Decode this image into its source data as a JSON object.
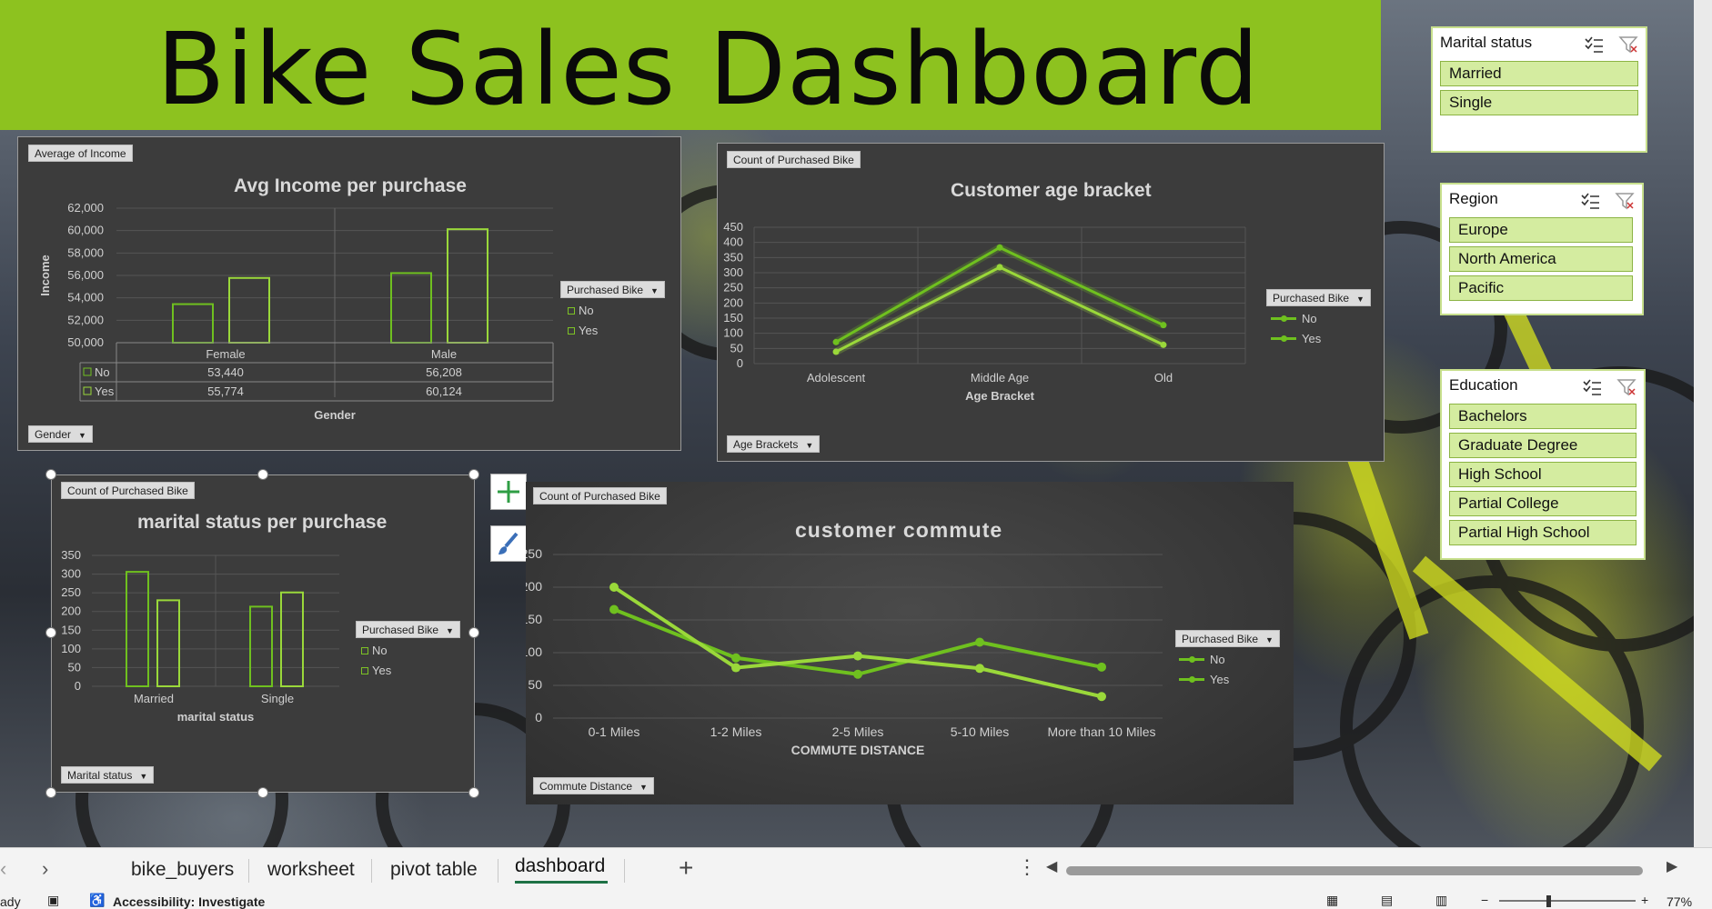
{
  "dashboard_title": "Bike Sales Dashboard",
  "colors": {
    "banner": "#8dc21f",
    "series_no": "#6fc01f",
    "series_yes": "#9ad83a",
    "chart_bg": "#3c3c3c",
    "slicer_item": "#d4eca0"
  },
  "charts": {
    "income": {
      "field_value": "Average of Income",
      "field_axis": "Gender",
      "legend_field": "Purchased Bike",
      "legend": [
        "No",
        "Yes"
      ],
      "table_rows": [
        {
          "label": "No",
          "female": "53,440",
          "male": "56,208"
        },
        {
          "label": "Yes",
          "female": "55,774",
          "male": "60,124"
        }
      ]
    },
    "age": {
      "field_value": "Count of Purchased Bike",
      "field_axis": "Age  Brackets",
      "legend_field": "Purchased Bike",
      "legend": [
        "No",
        "Yes"
      ]
    },
    "marital": {
      "field_value": "Count of Purchased Bike",
      "field_axis": "Marital status",
      "legend_field": "Purchased Bike",
      "legend": [
        "No",
        "Yes"
      ]
    },
    "commute": {
      "field_value": "Count of Purchased Bike",
      "field_axis": "Commute Distance",
      "legend_field": "Purchased Bike",
      "legend": [
        "No",
        "Yes"
      ]
    }
  },
  "chart_data": [
    {
      "type": "bar",
      "title": "Avg Income per purchase",
      "xlabel": "Gender",
      "ylabel": "Income",
      "categories": [
        "Female",
        "Male"
      ],
      "series": [
        {
          "name": "No",
          "values": [
            53440,
            56208
          ]
        },
        {
          "name": "Yes",
          "values": [
            55774,
            60124
          ]
        }
      ],
      "ylim": [
        50000,
        62000
      ],
      "yticks": [
        "50,000",
        "52,000",
        "54,000",
        "56,000",
        "58,000",
        "60,000",
        "62,000"
      ]
    },
    {
      "type": "line",
      "title": "Customer age bracket",
      "xlabel": "Age Bracket",
      "ylabel": "",
      "categories": [
        "Adolescent",
        "Middle Age",
        "Old"
      ],
      "series": [
        {
          "name": "No",
          "values": [
            71,
            383,
            127
          ]
        },
        {
          "name": "Yes",
          "values": [
            39,
            318,
            62
          ]
        }
      ],
      "ylim": [
        0,
        450
      ],
      "yticks": [
        "0",
        "50",
        "100",
        "150",
        "200",
        "250",
        "300",
        "350",
        "400",
        "450"
      ]
    },
    {
      "type": "bar",
      "title": "marital status per purchase",
      "xlabel": "marital status",
      "ylabel": "",
      "categories": [
        "Married",
        "Single"
      ],
      "series": [
        {
          "name": "No",
          "values": [
            306,
            213
          ]
        },
        {
          "name": "Yes",
          "values": [
            230,
            251
          ]
        }
      ],
      "ylim": [
        0,
        350
      ],
      "yticks": [
        "0",
        "50",
        "100",
        "150",
        "200",
        "250",
        "300",
        "350"
      ]
    },
    {
      "type": "line",
      "title": "customer commute",
      "xlabel": "COMMUTE DISTANCE",
      "ylabel": "",
      "categories": [
        "0-1 Miles",
        "1-2 Miles",
        "2-5 Miles",
        "5-10 Miles",
        "More than 10 Miles"
      ],
      "series": [
        {
          "name": "No",
          "values": [
            166,
            92,
            67,
            116,
            78
          ]
        },
        {
          "name": "Yes",
          "values": [
            200,
            77,
            95,
            76,
            33
          ]
        }
      ],
      "ylim": [
        0,
        250
      ],
      "yticks": [
        "0",
        "50",
        "100",
        "150",
        "200",
        "250"
      ]
    }
  ],
  "slicers": {
    "marital": {
      "title": "Marital status",
      "items": [
        "Married",
        "Single"
      ]
    },
    "region": {
      "title": "Region",
      "items": [
        "Europe",
        "North America",
        "Pacific"
      ]
    },
    "education": {
      "title": "Education",
      "items": [
        "Bachelors",
        "Graduate Degree",
        "High School",
        "Partial College",
        "Partial High School"
      ]
    }
  },
  "sheet_tabs": [
    "bike_buyers",
    "worksheet",
    "pivot table",
    "dashboard"
  ],
  "active_tab": "dashboard",
  "status": {
    "ready": "ady",
    "accessibility": "Accessibility: Investigate",
    "zoom": "77%"
  }
}
